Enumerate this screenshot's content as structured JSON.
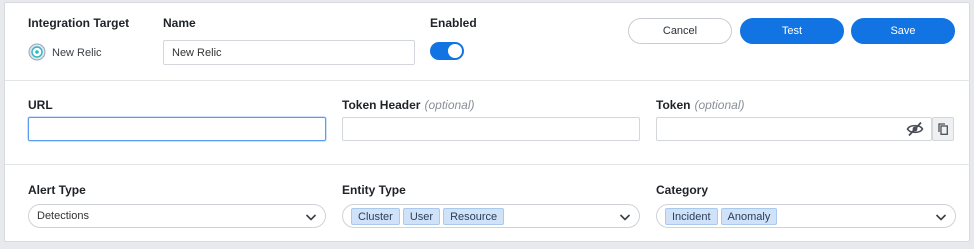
{
  "header": {
    "integration_target_label": "Integration Target",
    "integration_target_value": "New Relic",
    "name_label": "Name",
    "name_value": "New Relic",
    "enabled_label": "Enabled",
    "enabled": true,
    "cancel_label": "Cancel",
    "test_label": "Test",
    "save_label": "Save"
  },
  "connection": {
    "url_label": "URL",
    "url_value": "",
    "token_header_label": "Token Header",
    "token_header_optional": "(optional)",
    "token_header_value": "",
    "token_label": "Token",
    "token_optional": "(optional)",
    "token_value": ""
  },
  "filters": {
    "alert_type_label": "Alert Type",
    "alert_type_value": "Detections",
    "entity_type_label": "Entity Type",
    "entity_type_chips": [
      "Cluster",
      "User",
      "Resource"
    ],
    "category_label": "Category",
    "category_chips": [
      "Incident",
      "Anomaly"
    ]
  },
  "colors": {
    "accent": "#1273e3",
    "chip_bg": "#cfe2f8",
    "focus": "#5b9cf3"
  }
}
